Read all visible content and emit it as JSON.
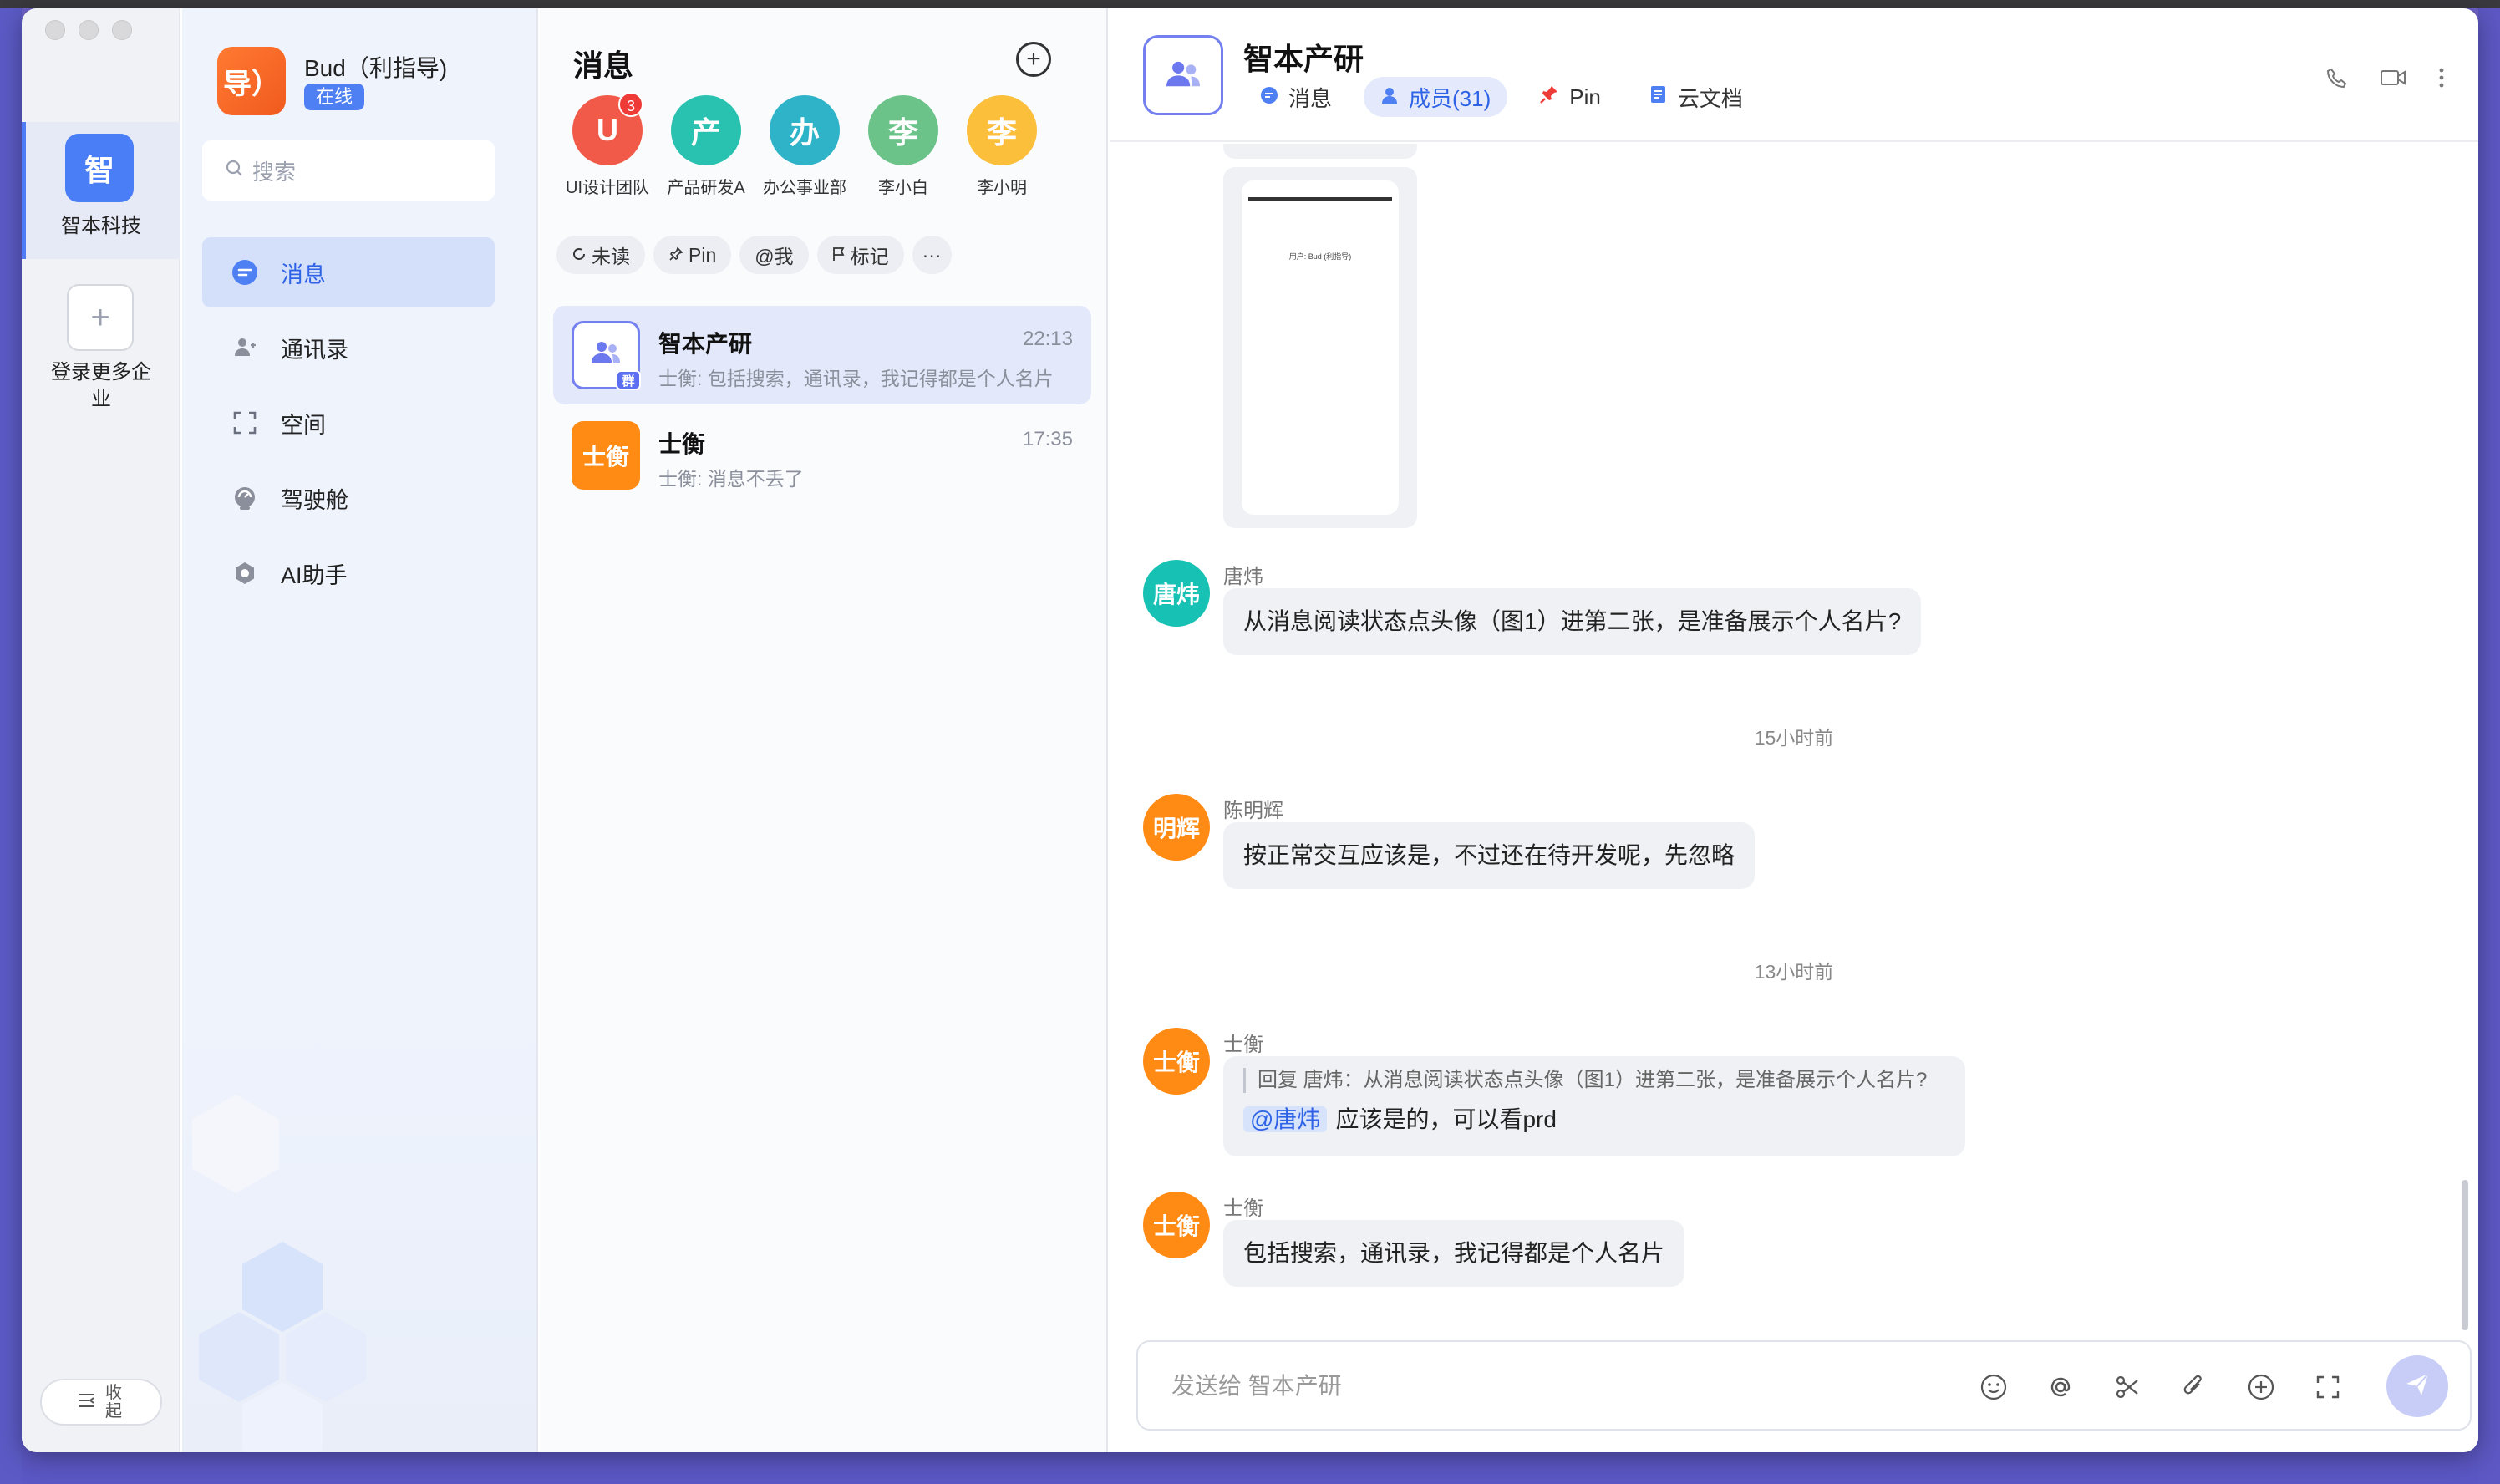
{
  "colors": {
    "accent": "#4e7ff3",
    "badge_red": "#ef3b38",
    "orange": "#ff8a14",
    "teal": "#17c1b3"
  },
  "rail": {
    "org": {
      "logo": "智",
      "name": "智本科技"
    },
    "add_label": "登录更多企业",
    "collapse_label": "收起"
  },
  "nav": {
    "user": {
      "avatar": "导）",
      "name": "Bud（利指导)",
      "status": "在线"
    },
    "search_placeholder": "搜索",
    "items": [
      {
        "label": "消息",
        "icon": "chat-icon",
        "active": true
      },
      {
        "label": "通讯录",
        "icon": "contacts-icon"
      },
      {
        "label": "空间",
        "icon": "space-icon"
      },
      {
        "label": "驾驶舱",
        "icon": "cockpit-icon"
      },
      {
        "label": "AI助手",
        "icon": "ai-assistant-icon"
      }
    ]
  },
  "conversations": {
    "title": "消息",
    "pinned": [
      {
        "initial": "U",
        "name": "UI设计团队",
        "color": "#f15a48",
        "badge": "3"
      },
      {
        "initial": "产",
        "name": "产品研发A",
        "color": "#29c2b0"
      },
      {
        "initial": "办",
        "name": "办公事业部",
        "color": "#2fb3c8"
      },
      {
        "initial": "李",
        "name": "李小白",
        "color": "#6cc38a"
      },
      {
        "initial": "李",
        "name": "李小明",
        "color": "#fbbf3b"
      }
    ],
    "filters": [
      "未读",
      "Pin",
      "@我",
      "标记",
      "···"
    ],
    "items": [
      {
        "name": "智本产研",
        "time": "22:13",
        "preview": "士衡: 包括搜索，通讯录，我记得都是个人名片",
        "group_tag": "群",
        "active": true
      },
      {
        "name": "士衡",
        "avatar": "士衡",
        "time": "17:35",
        "preview": "士衡: 消息不丢了"
      }
    ]
  },
  "chat": {
    "title": "智本产研",
    "tabs": [
      {
        "label": "消息",
        "icon": "chat-icon"
      },
      {
        "label": "成员(31)",
        "icon": "member-icon",
        "active": true
      },
      {
        "label": "Pin",
        "icon": "pin-icon"
      },
      {
        "label": "云文档",
        "icon": "doc-icon"
      }
    ],
    "image_caption": "用户: Bud (利指导)",
    "messages": [
      {
        "avatar": "唐炜",
        "sender": "唐炜",
        "text": "从消息阅读状态点头像（图1）进第二张，是准备展示个人名片?"
      },
      {
        "separator": "15小时前"
      },
      {
        "avatar": "明辉",
        "sender": "陈明辉",
        "text": "按正常交互应该是，不过还在待开发呢，先忽略"
      },
      {
        "separator": "13小时前"
      },
      {
        "avatar": "士衡",
        "sender": "士衡",
        "quote": "回复 唐炜：从消息阅读状态点头像（图1）进第二张，是准备展示个人名片?",
        "mention": "@唐炜",
        "text": "应该是的，可以看prd"
      },
      {
        "avatar": "士衡",
        "sender": "士衡",
        "text": "包括搜索，通讯录，我记得都是个人名片"
      }
    ],
    "composer_placeholder": "发送给 智本产研"
  }
}
